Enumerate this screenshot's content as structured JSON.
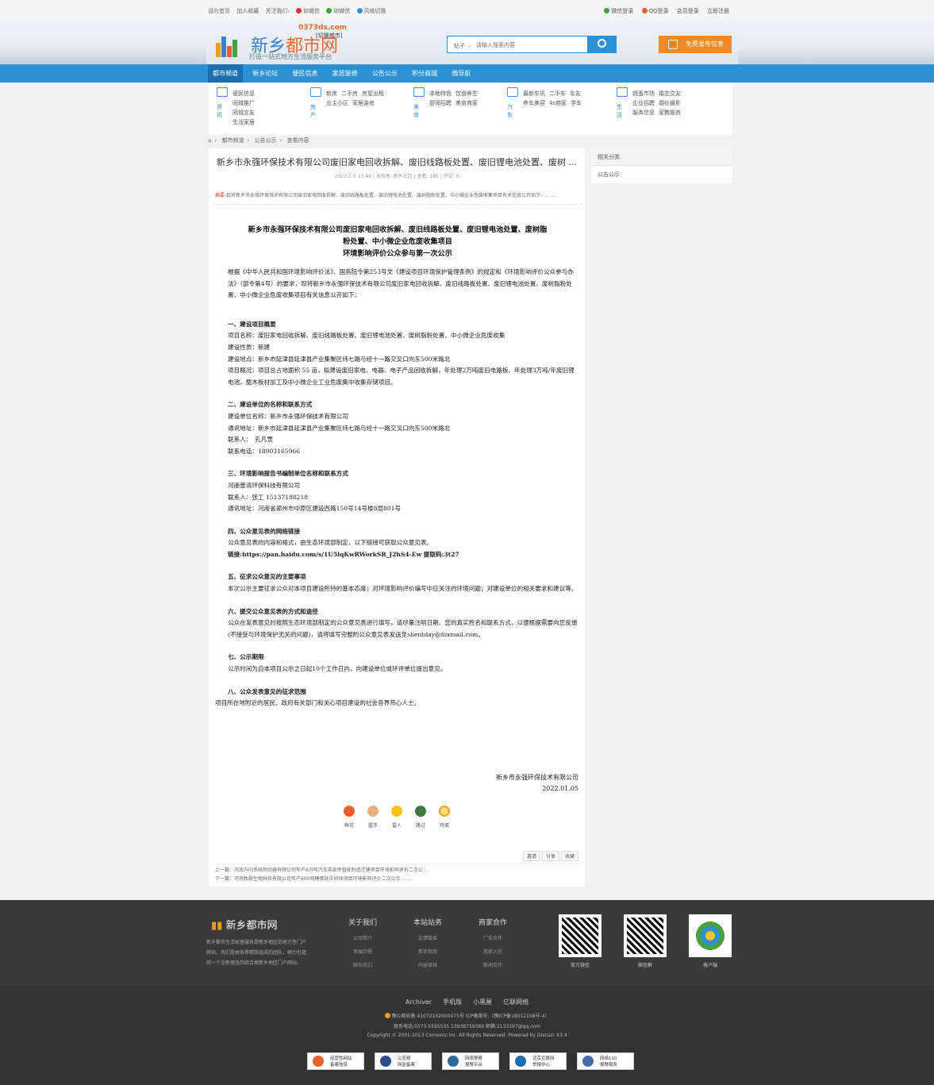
{
  "topbar": {
    "set_home": "设为首页",
    "add_fav": "加入收藏",
    "follow": "关注我们:",
    "weibo": "如微博",
    "weixin": "如微信",
    "style": "风格切换",
    "wx_login": "微信登录",
    "qq_login": "QQ登录",
    "member_login": "会员登录",
    "register": "立即注册"
  },
  "header": {
    "site_name_a": "新乡",
    "site_name_b": "都市网",
    "domain": "0373ds.com",
    "switch_city": "[切换城市]",
    "slogan": "打造一站式地方生活服务平台",
    "search_cat": "帖子",
    "search_placeholder": "请输入搜索内容",
    "publish": "免费发布信息"
  },
  "nav": [
    "都市频道",
    "新乡论坛",
    "便民信息",
    "家居装修",
    "公告公示",
    "积分商城",
    "微导航"
  ],
  "subnav": [
    {
      "cap": "资讯",
      "links": [
        "便民信息",
        "同城推广",
        "同城交友",
        "生活家居"
      ]
    },
    {
      "cap": "房产",
      "links": [
        "新房",
        "二手房",
        "房屋出租",
        "业主小区",
        "家居装修"
      ]
    },
    {
      "cap": "美食",
      "links": [
        "本地特色",
        "饮食养生",
        "厨师招聘",
        "美食商家"
      ]
    },
    {
      "cap": "汽车",
      "links": [
        "最新车讯",
        "二手车",
        "车友",
        "养车美容",
        "4s商家",
        "学车"
      ]
    },
    {
      "cap": "生活",
      "links": [
        "跳蚤市场",
        "婚恋交友",
        "企业招聘",
        "婚纱摄影",
        "服务信息",
        "家教服务"
      ]
    }
  ],
  "breadcrumb": [
    "都市频道",
    "公告公示",
    "查看内容"
  ],
  "side": {
    "header": "相关分类",
    "item": "公告公示"
  },
  "article": {
    "title": "新乡市永强环保技术有限公司废旧家电回收拆解、废旧线路板处置、废旧锂电池处置、废树 ...",
    "meta": "2022-1-5 13:48 | 发布者: 新乡社区 | 查看: 185 | 评论: 0",
    "summary_label": "摘要:",
    "summary": "现将新乡市永强环保技术有限公司废旧家电回收拆解、废旧线路板处置、废旧锂电池处置、废树脂粉处置、中小微企业危废收集项目有关信息公开如下：... ...",
    "heading1": "新乡市永强环保技术有限公司废旧家电回收拆解、废旧线路板处置、废旧锂电池处置、废树脂",
    "heading2": "粉处置、中小微企业危废收集项目",
    "heading3": "环境影响评价公众参与第一次公示",
    "intro": "根据《中华人民共和国环境影响评价法》、国务院令第253号文《建设项目环境保护管理条例》的规定和《环境影响评价公众参与办法》（部令第4号）的要求，现将新乡市永强环保技术有限公司废旧家电回收拆解、废旧线路板处置、废旧锂电池处置、废树脂粉处置、中小微企业危废收集项目有关信息公开如下：",
    "s1_title": "一、建设项目概要",
    "s1_l1": "项目名称：废旧家电回收拆解、废旧线路板处置、废旧锂电池处置、废树脂粉处置、中小微企业危废收集",
    "s1_l2": "建设性质：新建",
    "s1_l3": "建设地点：新乡市延津县延津县产业集聚区纬七路与经十一路交叉口向东500米路北",
    "s1_l4": "项目概况：项目总占地面积 55 亩，拟建设废旧家电、电器、电子产品回收拆解，年处理2万吨废旧电路板、年处理3万吨/年废旧锂电池，整木板材加工及中小微企业工业危废集中收集存储项目。",
    "s2_title": "二、建设单位的名称和联系方式",
    "s2_l1": "建设单位名称：新乡市永强环保技术有限公司",
    "s2_l2": "通讯地址：新乡市延津县延津县产业集聚区纬七路与经十一路交叉口向东500米路北",
    "s2_l3": "联系人：　孔凡罡",
    "s2_l4": "联系电话：18903165966",
    "s3_title": "三、环境影响报告书编制单位名称和联系方式",
    "s3_l1": "河南普清环保科技有限公司",
    "s3_l2": "联系人：张工 15137188218",
    "s3_l3": "通讯地址：河南省郑州市中原区建设西路150号14号楼8层801号",
    "s4_title": "四、公众意见表的网络链接",
    "s4_l1": "公众意见表的内容和格式，由生态环境部制定，以下链接可获取公众意见表。",
    "s4_l2": "链接:https://pan.baidu.com/s/1U5lqKwRWorkSR_J2hS4-Ew 提取码:3t27",
    "s5_title": "五、征求公众意见的主要事项",
    "s5_l1": "本次公示主要征求公众对本项目建设所持的基本态度；对环境影响评价编写中应关注的环境问题；对建设单位的相关要求和建议等。",
    "s6_title": "六、提交公众意见表的方式和途径",
    "s6_l1": "公众在发表意见时按照生态环境部制定的公众意见表进行填写，请尽量注明日期、您的真实姓名和联系方式，以便根据需要向您反馈(不接受与环境保护无关的问题)，请将填写完整的公众意见表发送至slientday@foxmail.com。",
    "s7_title": "七、公示期限",
    "s7_l1": "公示时间为自本项目公示之日起10个工作日内，向建设单位或环评单位提出意见。",
    "s8_title": "八、公众发表意见的征求范围",
    "s8_l1": "项目所在地附近的居民、政府有关部门和关心项目建设的社会各界热心人士。",
    "sign_company": "新乡市永强环保技术有限公司",
    "sign_date": "2022.01.05",
    "reactions": [
      "鲜花",
      "握手",
      "雷人",
      "路过",
      "鸡蛋"
    ],
    "actions": [
      "邀请",
      "分享",
      "收藏"
    ],
    "prev": "上一篇：河南万向系统制动器有限公司年产6万吨汽车零部件智能制造迁建项目环境影响评价二次公 ...",
    "next": "下一篇：河南牧歌生物科技有限公司年产600吨糖蛋肽中间体项目环境影响评价二次公示 ... ..."
  },
  "footer": {
    "name": "新乡都市网",
    "desc": "新乡都市生活家居服务是新乡地区的地方性门户网站，我们是由各界精英组成的团队，倾力打造的一个全新理念的综合类新乡地区门户网站。",
    "cols": [
      {
        "title": "关于我们",
        "items": [
          "公司简介",
          "发展历程",
          "联系我们"
        ]
      },
      {
        "title": "本站站务",
        "items": [
          "友情链接",
          "新手指南",
          "内容审核"
        ]
      },
      {
        "title": "商家合作",
        "items": [
          "广告合作",
          "商家入驻",
          "新闻合作"
        ]
      }
    ],
    "qr_labels": [
      "官方微信",
      "微信群",
      "客户端"
    ],
    "links": [
      "Archiver",
      "手机版",
      "小黑屋",
      "亿联网络"
    ],
    "beian": "豫公网安备 41072102000471号 ICP备案号:（豫ICP备18012158号-4）",
    "contact": "联系电话:0373-5595535 13938759389 邮箱:2133197@qq.com",
    "copyright": "Copyright © 2001-2013 Comsenz Inc. All Rights Reserved.  Powered by Discuz! X3.4",
    "badges": [
      [
        "经营性网站",
        "备案信息"
      ],
      [
        "公安局",
        "网监备案"
      ],
      [
        "网络警察",
        "报警平台"
      ],
      [
        "北京互联网",
        "举报中心"
      ],
      [
        "网络110",
        "报警服务"
      ]
    ]
  }
}
